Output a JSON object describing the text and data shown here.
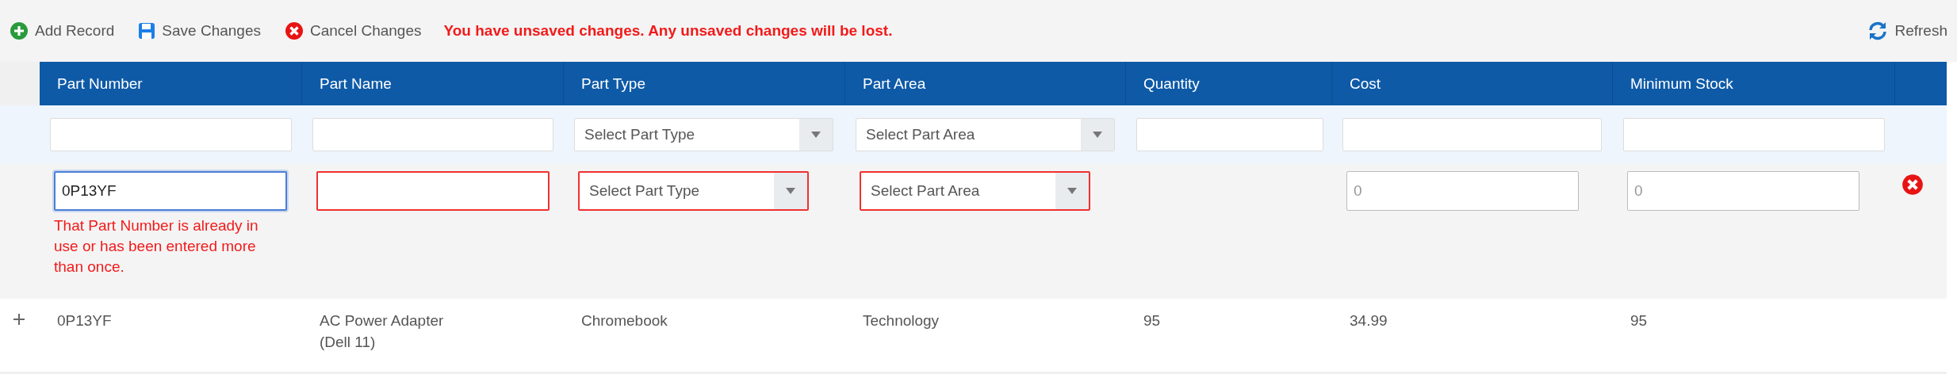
{
  "toolbar": {
    "buttons": [
      {
        "kind": "add",
        "label": "Add Record"
      },
      {
        "kind": "save",
        "label": "Save Changes"
      },
      {
        "kind": "cancel",
        "label": "Cancel Changes"
      }
    ],
    "message": "You have unsaved changes. Any unsaved changes will be lost.",
    "refresh": {
      "label": "Refresh"
    }
  },
  "table": {
    "columns": [
      "Part Number",
      "Part Name",
      "Part Type",
      "Part Area",
      "Quantity",
      "Cost",
      "Minimum Stock"
    ],
    "filter_row": [
      {
        "kind": "text"
      },
      {
        "kind": "text"
      },
      {
        "kind": "select",
        "placeholder": "Select Part Type"
      },
      {
        "kind": "select",
        "placeholder": "Select Part Area"
      },
      {
        "kind": "text"
      },
      {
        "kind": "text"
      },
      {
        "kind": "text"
      }
    ],
    "edit_row": {
      "fields": [
        {
          "kind": "text",
          "value": "0P13YF",
          "focused": true,
          "invalid": false,
          "error": "That Part Number is already in use or has been entered more than once."
        },
        {
          "kind": "text",
          "invalid": true
        },
        {
          "kind": "select",
          "placeholder": "Select Part Type",
          "invalid": true
        },
        {
          "kind": "select",
          "placeholder": "Select Part Area",
          "invalid": true
        },
        {
          "kind": "none"
        },
        {
          "kind": "text",
          "placeholder": "0",
          "invalid": false
        },
        {
          "kind": "text",
          "placeholder": "0",
          "invalid": false
        }
      ],
      "removable": true
    },
    "rows": [
      {
        "expanded": false,
        "cells": [
          "0P13YF",
          "AC Power Adapter (Dell 11)",
          "Chromebook",
          "Technology",
          "95",
          "34.99",
          "95"
        ]
      }
    ]
  }
}
